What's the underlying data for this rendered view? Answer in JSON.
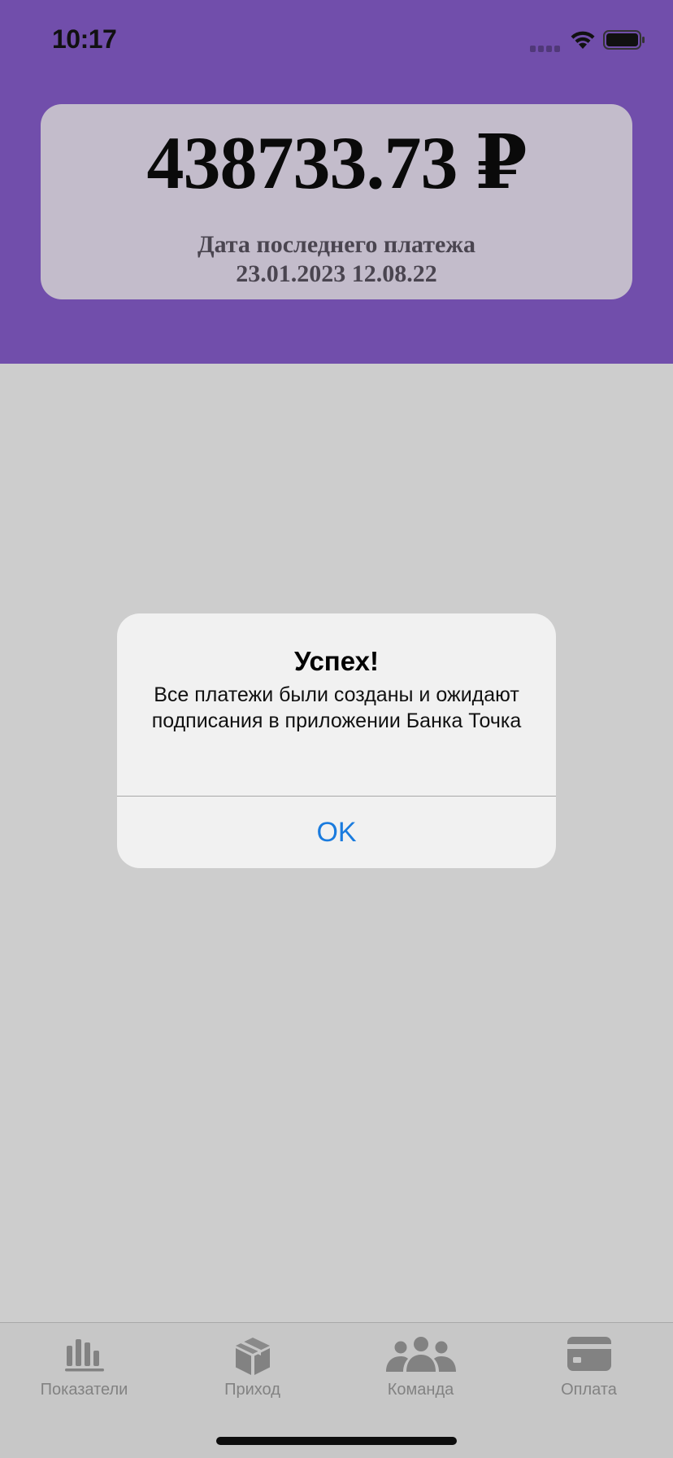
{
  "status_bar": {
    "time": "10:17",
    "icons": [
      "signal-icon",
      "wifi-icon",
      "battery-icon"
    ]
  },
  "balance": {
    "amount": "438733.73 ₽",
    "last_payment_label": "Дата последнего платежа",
    "last_payment_date": "23.01.2023 12.08.22"
  },
  "alert": {
    "title": "Успех!",
    "message": "Все платежи были созданы и ожидают подписания в приложении Банка Точка",
    "ok_label": "OK"
  },
  "tab_bar": {
    "items": [
      {
        "label": "Показатели",
        "icon": "bar-chart-icon"
      },
      {
        "label": "Приход",
        "icon": "box-icon"
      },
      {
        "label": "Команда",
        "icon": "team-icon"
      },
      {
        "label": "Оплата",
        "icon": "credit-card-icon"
      }
    ]
  },
  "colors": {
    "header": "#714eab",
    "card": "#c3bccb",
    "overlay_background": "#cdcdcd",
    "alert_button": "#1a7bde",
    "tab_icon": "#828282"
  }
}
